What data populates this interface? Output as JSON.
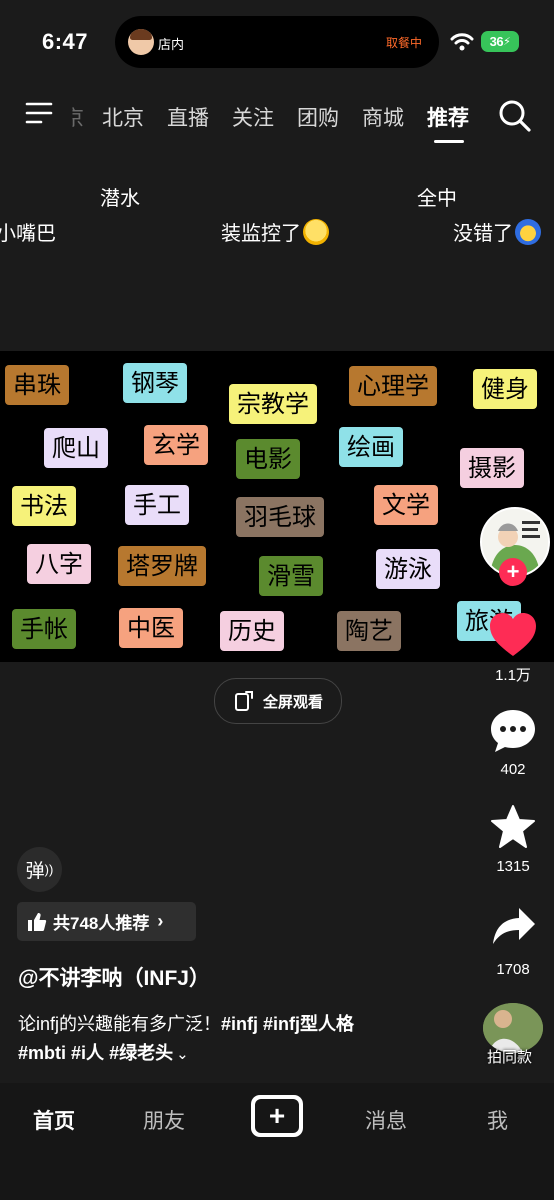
{
  "status_bar": {
    "time": "6:47",
    "island_left": "店内",
    "island_right": "取餐中",
    "battery": "36"
  },
  "nav": {
    "tabs": [
      {
        "label": "京",
        "state": "faded"
      },
      {
        "label": "北京",
        "state": "normal"
      },
      {
        "label": "直播",
        "state": "normal"
      },
      {
        "label": "关注",
        "state": "normal"
      },
      {
        "label": "团购",
        "state": "normal"
      },
      {
        "label": "商城",
        "state": "normal"
      },
      {
        "label": "推荐",
        "state": "active"
      }
    ]
  },
  "danmaku": [
    {
      "text": "潜水"
    },
    {
      "text": "全中"
    },
    {
      "text": "小嘴巴"
    },
    {
      "text": "装监控了"
    },
    {
      "text": "没错了"
    }
  ],
  "video_tags": [
    {
      "text": "串珠",
      "color": "#b7782f"
    },
    {
      "text": "钢琴",
      "color": "#8fe1e8"
    },
    {
      "text": "宗教学",
      "color": "#f6f27a"
    },
    {
      "text": "心理学",
      "color": "#b7782f"
    },
    {
      "text": "健身",
      "color": "#f6f27a"
    },
    {
      "text": "爬山",
      "color": "#e9ddf9"
    },
    {
      "text": "玄学",
      "color": "#f6a27f"
    },
    {
      "text": "电影",
      "color": "#5b8a2e"
    },
    {
      "text": "绘画",
      "color": "#8fe1e8"
    },
    {
      "text": "摄影",
      "color": "#f5cfe0"
    },
    {
      "text": "书法",
      "color": "#f6f27a"
    },
    {
      "text": "手工",
      "color": "#e9ddf9"
    },
    {
      "text": "羽毛球",
      "color": "#8b7462"
    },
    {
      "text": "文学",
      "color": "#f6a27f"
    },
    {
      "text": "八字",
      "color": "#f5cfe0"
    },
    {
      "text": "塔罗牌",
      "color": "#b7782f"
    },
    {
      "text": "滑雪",
      "color": "#5b8a2e"
    },
    {
      "text": "游泳",
      "color": "#e9ddf9"
    },
    {
      "text": "手帐",
      "color": "#5b8a2e"
    },
    {
      "text": "中医",
      "color": "#f6a27f"
    },
    {
      "text": "历史",
      "color": "#f5cfe0"
    },
    {
      "text": "陶艺",
      "color": "#8b7462"
    },
    {
      "text": "旅游",
      "color": "#8fe1e8"
    }
  ],
  "fullscreen_label": "全屏观看",
  "rail": {
    "likes": "1.1万",
    "comments": "402",
    "favorites": "1315",
    "shares": "1708",
    "same_style": "拍同款"
  },
  "danmaku_toggle": "弹",
  "recommend_label": "共748人推荐",
  "author": "@不讲李呐（INFJ）",
  "description": {
    "text": "论infj的兴趣能有多广泛！",
    "tags_line1": [
      "#infj",
      "#infj型人格"
    ],
    "tags_line2": [
      "#mbti",
      "#i人",
      "#绿老头"
    ]
  },
  "bottom_nav": {
    "home": "首页",
    "friends": "朋友",
    "messages": "消息",
    "me": "我"
  },
  "colors": {
    "accent": "#fe2c55",
    "background": "#1b1b1b",
    "battery": "#37c45a",
    "island_status": "#ff6a2a"
  }
}
